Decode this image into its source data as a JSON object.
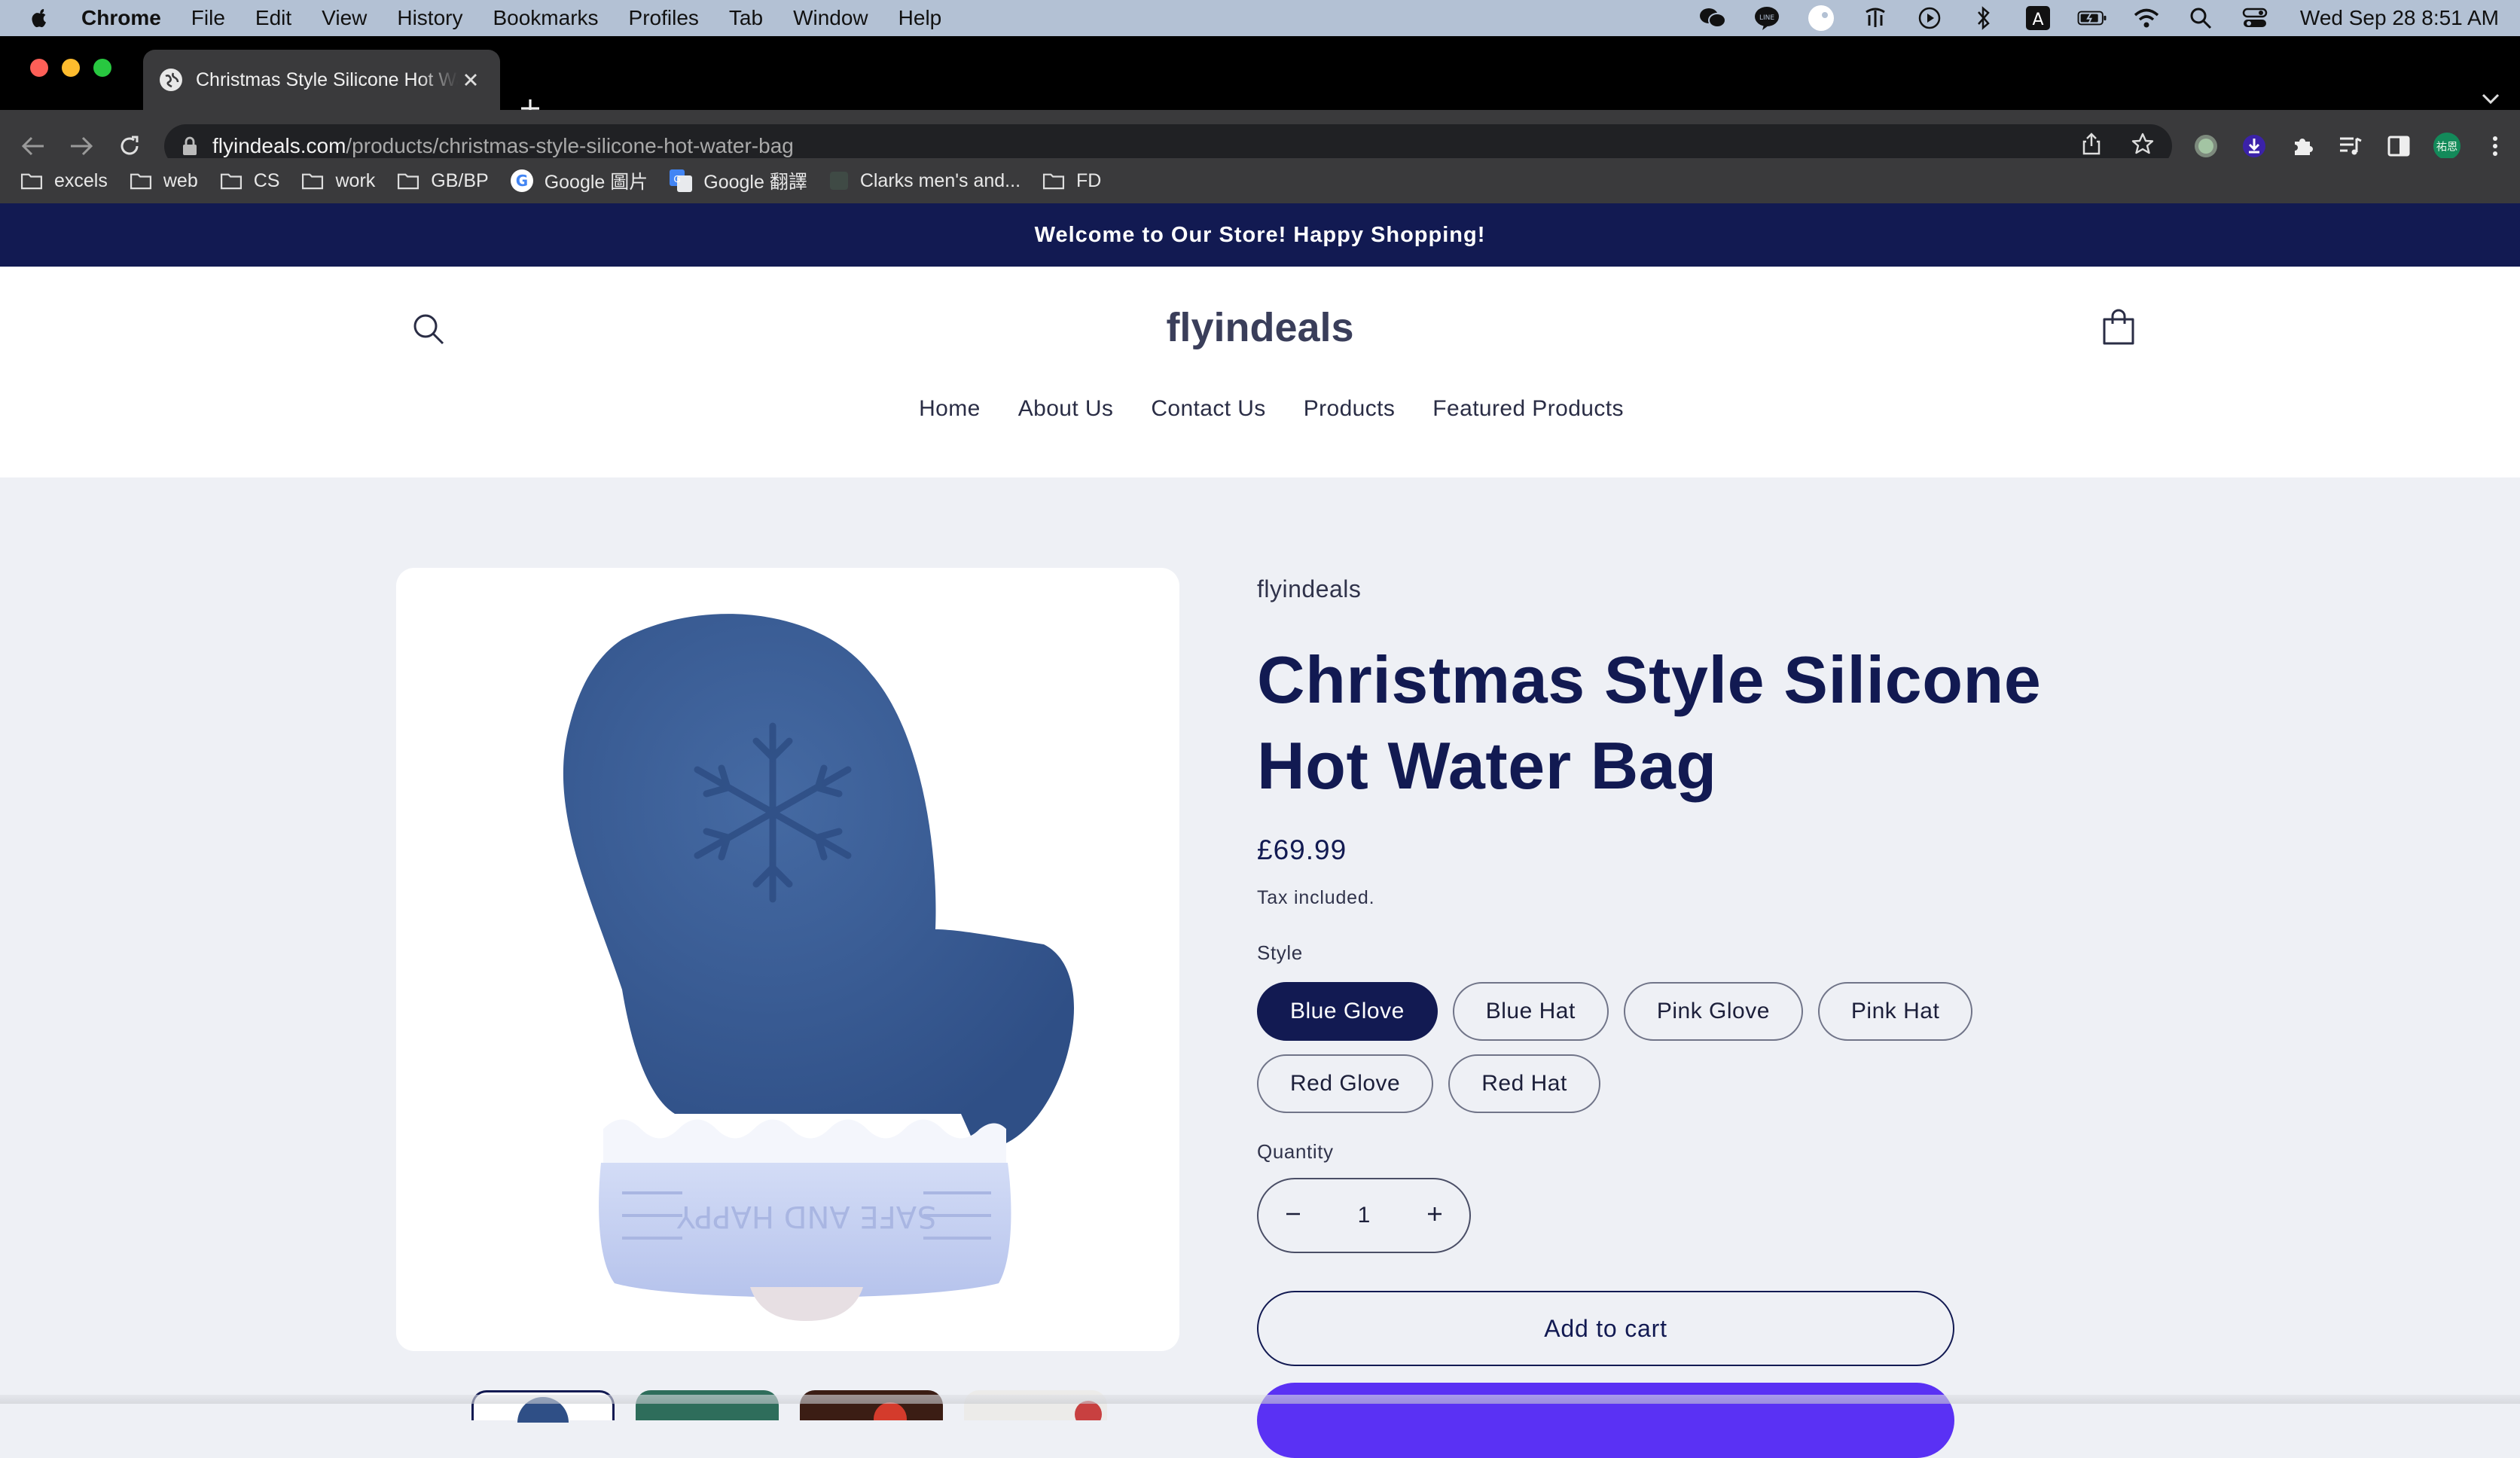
{
  "menubar": {
    "app_name": "Chrome",
    "items": [
      "File",
      "Edit",
      "View",
      "History",
      "Bookmarks",
      "Profiles",
      "Tab",
      "Window",
      "Help"
    ],
    "clock": "Wed Sep 28  8:51 AM"
  },
  "browser": {
    "tab_title": "Christmas Style Silicone Hot Water Bag",
    "url_host": "flyindeals.com",
    "url_path": "/products/christmas-style-silicone-hot-water-bag",
    "bookmarks": [
      {
        "label": "excels",
        "icon": "folder-icon"
      },
      {
        "label": "web",
        "icon": "folder-icon"
      },
      {
        "label": "CS",
        "icon": "folder-icon"
      },
      {
        "label": "work",
        "icon": "folder-icon"
      },
      {
        "label": "GB/BP",
        "icon": "folder-icon"
      },
      {
        "label": "Google 圖片",
        "icon": "google-icon"
      },
      {
        "label": "Google 翻譯",
        "icon": "google-translate-icon"
      },
      {
        "label": "Clarks men's and...",
        "icon": "site-icon"
      },
      {
        "label": "FD",
        "icon": "folder-icon"
      }
    ]
  },
  "store": {
    "announcement": "Welcome to Our Store! Happy Shopping!",
    "logo": "flyindeals",
    "nav": [
      "Home",
      "About Us",
      "Contact Us",
      "Products",
      "Featured Products"
    ]
  },
  "product": {
    "vendor": "flyindeals",
    "title": "Christmas Style Silicone Hot Water Bag",
    "price": "£69.99",
    "tax_note": "Tax included.",
    "style_label": "Style",
    "styles": [
      "Blue Glove",
      "Blue Hat",
      "Pink Glove",
      "Pink Hat",
      "Red Glove",
      "Red Hat"
    ],
    "selected_style": "Blue Glove",
    "quantity_label": "Quantity",
    "quantity": "1",
    "add_to_cart": "Add to cart",
    "image_text": "SAFE AND HAPPY"
  },
  "colors": {
    "navy": "#121a52",
    "glove_blue": "#3a5a92",
    "cuff": "#c9d3f2",
    "buy_now": "#5a31f4"
  }
}
